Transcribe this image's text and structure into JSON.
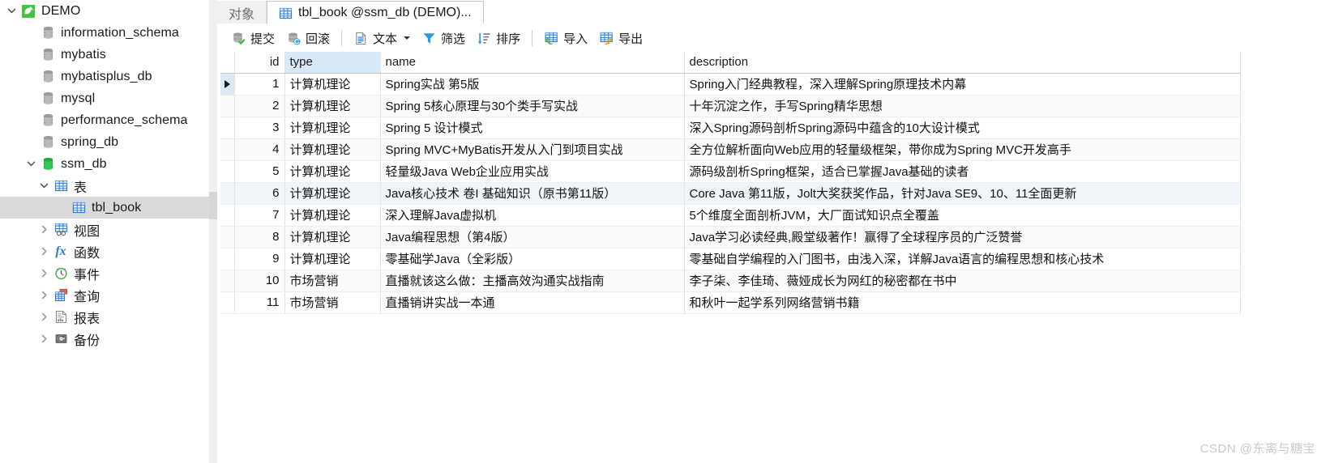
{
  "sidebar": {
    "items": [
      {
        "label": "DEMO",
        "icon": "dolphin-icon",
        "level": 0,
        "twisty": "down",
        "selected": false,
        "kind": "connection"
      },
      {
        "label": "information_schema",
        "icon": "database-icon",
        "level": 1,
        "twisty": "none",
        "selected": false,
        "kind": "db"
      },
      {
        "label": "mybatis",
        "icon": "database-icon",
        "level": 1,
        "twisty": "none",
        "selected": false,
        "kind": "db"
      },
      {
        "label": "mybatisplus_db",
        "icon": "database-icon",
        "level": 1,
        "twisty": "none",
        "selected": false,
        "kind": "db"
      },
      {
        "label": "mysql",
        "icon": "database-icon",
        "level": 1,
        "twisty": "none",
        "selected": false,
        "kind": "db"
      },
      {
        "label": "performance_schema",
        "icon": "database-icon",
        "level": 1,
        "twisty": "none",
        "selected": false,
        "kind": "db"
      },
      {
        "label": "spring_db",
        "icon": "database-icon",
        "level": 1,
        "twisty": "none",
        "selected": false,
        "kind": "db"
      },
      {
        "label": "ssm_db",
        "icon": "database-open-icon",
        "level": 1,
        "twisty": "down",
        "selected": false,
        "kind": "db-active"
      },
      {
        "label": "表",
        "icon": "table-icon",
        "level": 2,
        "twisty": "down",
        "selected": false,
        "kind": "folder"
      },
      {
        "label": "tbl_book",
        "icon": "table-icon",
        "level": 3,
        "twisty": "none",
        "selected": true,
        "kind": "table"
      },
      {
        "label": "视图",
        "icon": "view-icon",
        "level": 2,
        "twisty": "right",
        "selected": false,
        "kind": "folder"
      },
      {
        "label": "函数",
        "icon": "function-icon",
        "level": 2,
        "twisty": "right",
        "selected": false,
        "kind": "folder"
      },
      {
        "label": "事件",
        "icon": "event-clock-icon",
        "level": 2,
        "twisty": "right",
        "selected": false,
        "kind": "folder"
      },
      {
        "label": "查询",
        "icon": "query-icon",
        "level": 2,
        "twisty": "right",
        "selected": false,
        "kind": "folder"
      },
      {
        "label": "报表",
        "icon": "report-icon",
        "level": 2,
        "twisty": "right",
        "selected": false,
        "kind": "folder"
      },
      {
        "label": "备份",
        "icon": "backup-icon",
        "level": 2,
        "twisty": "right",
        "selected": false,
        "kind": "folder"
      }
    ]
  },
  "tabs": [
    {
      "label": "对象",
      "icon": "none",
      "active": false
    },
    {
      "label": "tbl_book @ssm_db (DEMO)...",
      "icon": "table-icon",
      "active": true
    }
  ],
  "toolbar": {
    "groups": [
      [
        {
          "label": "提交",
          "icon": "commit-icon",
          "caret": false
        },
        {
          "label": "回滚",
          "icon": "rollback-icon",
          "caret": false
        }
      ],
      [
        {
          "label": "文本",
          "icon": "text-icon",
          "caret": true
        },
        {
          "label": "筛选",
          "icon": "filter-icon",
          "caret": false
        },
        {
          "label": "排序",
          "icon": "sort-icon",
          "caret": false
        }
      ],
      [
        {
          "label": "导入",
          "icon": "import-icon",
          "caret": false
        },
        {
          "label": "导出",
          "icon": "export-icon",
          "caret": false
        }
      ]
    ]
  },
  "grid": {
    "columns": [
      {
        "key": "id",
        "label": "id",
        "highlight": false
      },
      {
        "key": "type",
        "label": "type",
        "highlight": true
      },
      {
        "key": "name",
        "label": "name",
        "highlight": false
      },
      {
        "key": "description",
        "label": "description",
        "highlight": false
      }
    ],
    "rows": [
      {
        "id": "1",
        "type": "计算机理论",
        "name": "Spring实战 第5版",
        "description": "Spring入门经典教程，深入理解Spring原理技术内幕",
        "current": true,
        "highlight": false
      },
      {
        "id": "2",
        "type": "计算机理论",
        "name": "Spring 5核心原理与30个类手写实战",
        "description": "十年沉淀之作，手写Spring精华思想",
        "current": false,
        "highlight": false
      },
      {
        "id": "3",
        "type": "计算机理论",
        "name": "Spring 5 设计模式",
        "description": "深入Spring源码剖析Spring源码中蕴含的10大设计模式",
        "current": false,
        "highlight": false
      },
      {
        "id": "4",
        "type": "计算机理论",
        "name": "Spring MVC+MyBatis开发从入门到项目实战",
        "description": "全方位解析面向Web应用的轻量级框架，带你成为Spring MVC开发高手",
        "current": false,
        "highlight": false
      },
      {
        "id": "5",
        "type": "计算机理论",
        "name": "轻量级Java Web企业应用实战",
        "description": "源码级剖析Spring框架，适合已掌握Java基础的读者",
        "current": false,
        "highlight": false
      },
      {
        "id": "6",
        "type": "计算机理论",
        "name": "Java核心技术 卷I 基础知识（原书第11版）",
        "description": "Core Java 第11版，Jolt大奖获奖作品，针对Java SE9、10、11全面更新",
        "current": false,
        "highlight": true
      },
      {
        "id": "7",
        "type": "计算机理论",
        "name": "深入理解Java虚拟机",
        "description": "5个维度全面剖析JVM，大厂面试知识点全覆盖",
        "current": false,
        "highlight": false
      },
      {
        "id": "8",
        "type": "计算机理论",
        "name": "Java编程思想（第4版）",
        "description": "Java学习必读经典,殿堂级著作！赢得了全球程序员的广泛赞誉",
        "current": false,
        "highlight": false
      },
      {
        "id": "9",
        "type": "计算机理论",
        "name": "零基础学Java（全彩版）",
        "description": "零基础自学编程的入门图书，由浅入深，详解Java语言的编程思想和核心技术",
        "current": false,
        "highlight": false
      },
      {
        "id": "10",
        "type": "市场营销",
        "name": "直播就该这么做：主播高效沟通实战指南",
        "description": "李子柒、李佳琦、薇娅成长为网红的秘密都在书中",
        "current": false,
        "highlight": false
      },
      {
        "id": "11",
        "type": "市场营销",
        "name": "直播销讲实战一本通",
        "description": "和秋叶一起学系列网络营销书籍",
        "current": false,
        "highlight": false
      }
    ]
  },
  "watermark": {
    "text": "CSDN @东离与糖宝"
  },
  "colors": {
    "selection": "#d9d9d9",
    "header_highlight": "#d7e8f7",
    "row_highlight": "#eef5fb",
    "accent_blue": "#2b7cd3",
    "accent_green": "#31b14b"
  }
}
